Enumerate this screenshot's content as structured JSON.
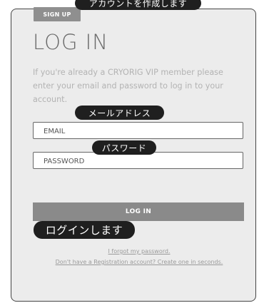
{
  "tabs": {
    "signup_label": "SIGN UP"
  },
  "form": {
    "title": "LOG IN",
    "intro": "If you're already a CRYORIG VIP member please enter your email and password to log in to your account.",
    "email_placeholder": "EMAIL",
    "password_placeholder": "PASSWORD",
    "login_label": "LOG IN"
  },
  "links": {
    "forgot": "I forgot my password.",
    "register": "Don't have a Registration account? Create one in seconds."
  },
  "annotations": {
    "create_account": "アカウントを作成します",
    "email": "メールアドレス",
    "password": "パスワード",
    "login": "ログインします"
  },
  "colors": {
    "panel_bg": "#ececec",
    "button_bg": "#8a8a8a",
    "annotation_bg": "#1f1f1f"
  }
}
